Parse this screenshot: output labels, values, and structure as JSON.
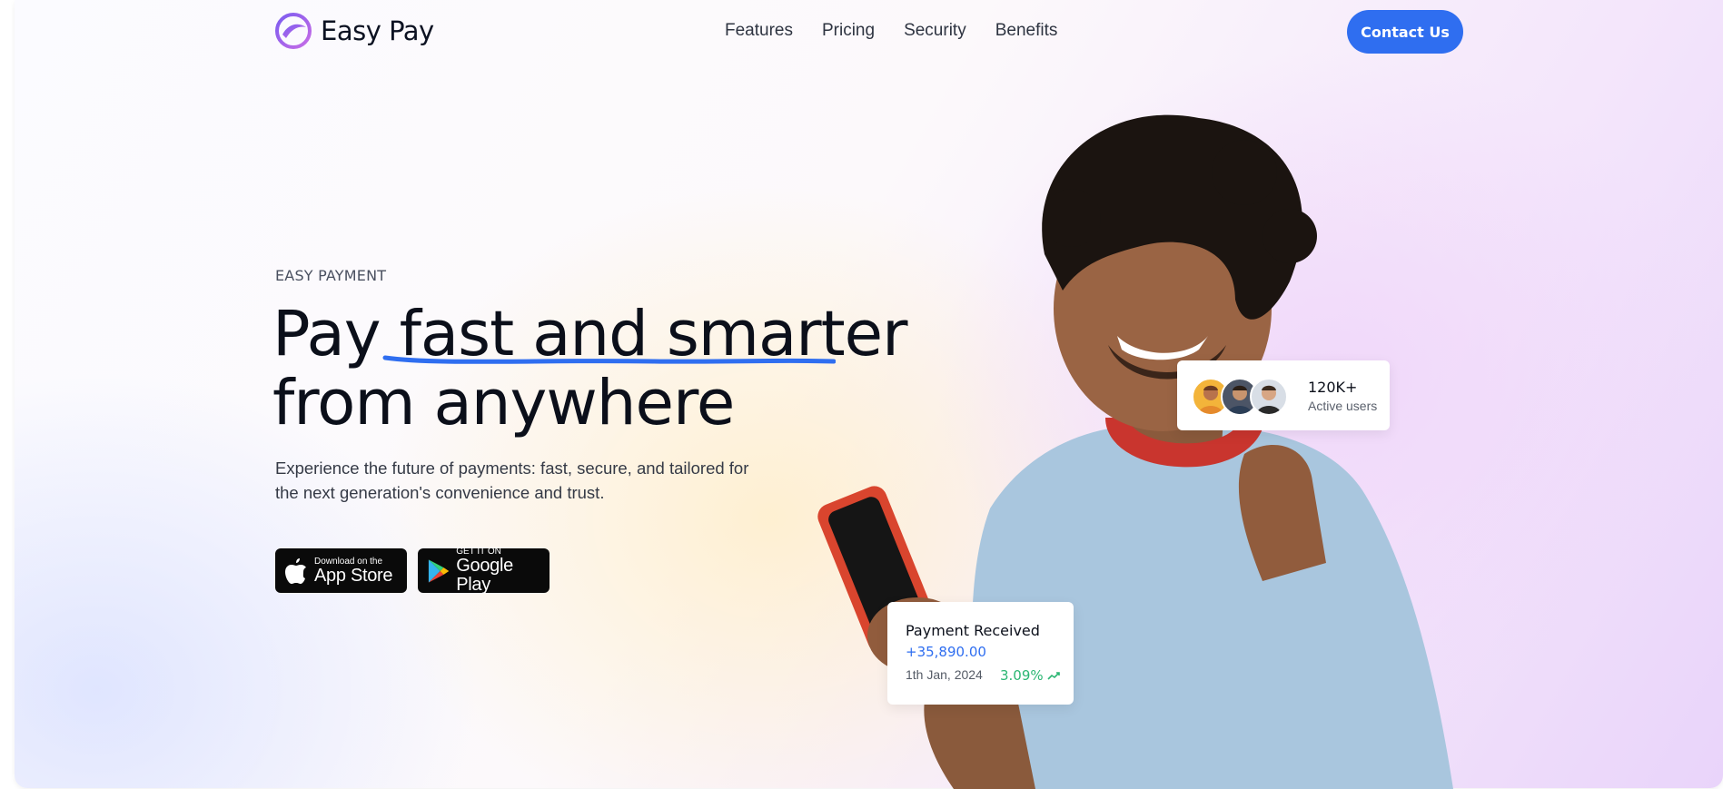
{
  "brand": {
    "name": "Easy Pay",
    "accent": "#2f6ef0"
  },
  "nav": {
    "links": [
      "Features",
      "Pricing",
      "Security",
      "Benefits"
    ],
    "cta": "Contact Us"
  },
  "hero": {
    "eyebrow": "EASY PAYMENT",
    "headline_part1": "Pay ",
    "headline_accent": "fast and smarter",
    "headline_line2": "from anywhere",
    "subtext": "Experience the future of payments: fast, secure, and tailored for the next generation's convenience and trust."
  },
  "stores": {
    "apple": {
      "small": "Download on the",
      "big": "App Store",
      "icon": "apple-icon"
    },
    "google": {
      "small": "GET IT ON",
      "big": "Google Play",
      "icon": "google-play-icon"
    }
  },
  "users_card": {
    "count": "120K+",
    "label": "Active users"
  },
  "payment_card": {
    "title": "Payment Received",
    "amount": "+35,890.00",
    "date": "1th Jan, 2024",
    "change": "3.09%",
    "change_color": "#2bb673"
  }
}
